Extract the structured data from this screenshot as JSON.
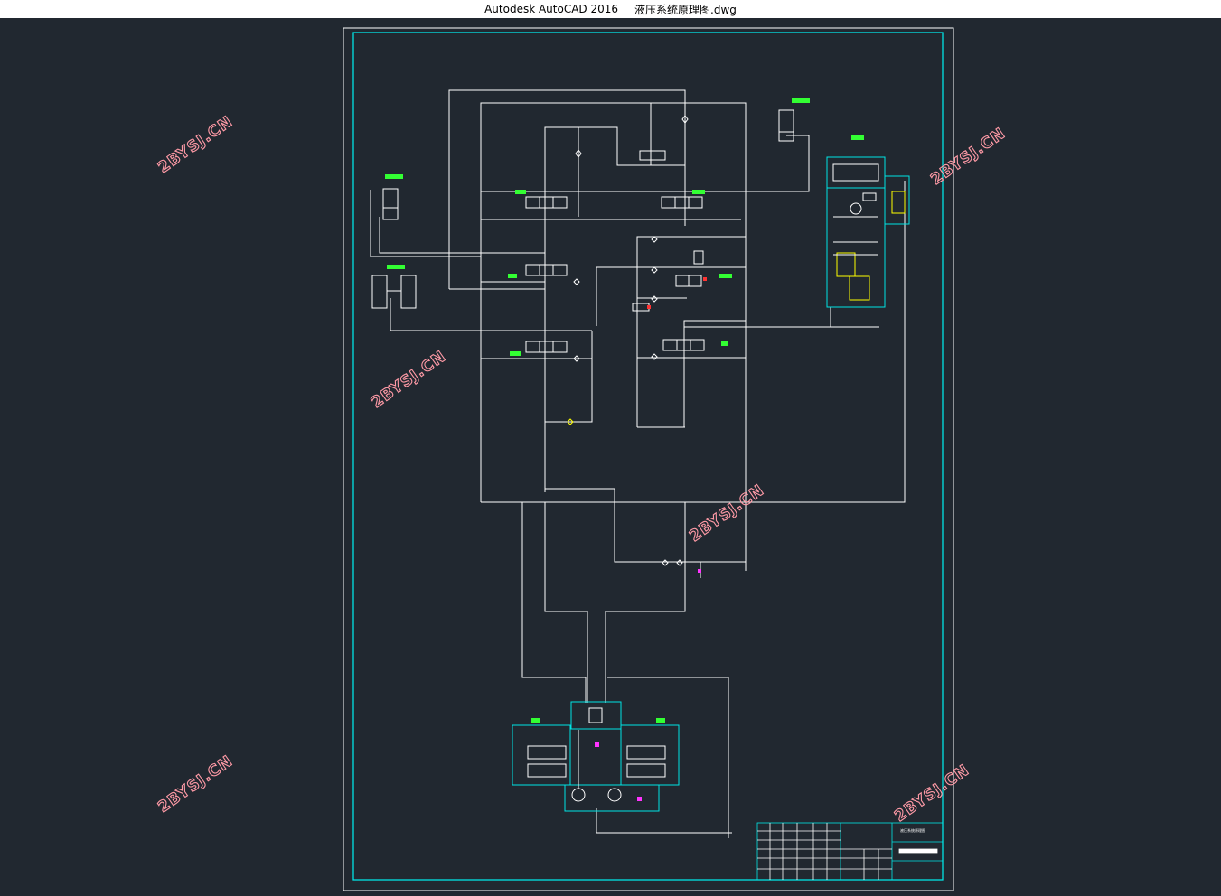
{
  "window": {
    "app_name": "Autodesk AutoCAD 2016",
    "file_name": "液压系统原理图.dwg"
  },
  "watermark": {
    "text": "2BYSJ.CN",
    "color": "#ff9aa6"
  },
  "colors": {
    "background": "#212830",
    "lines": "#ffffff",
    "frame_inner": "#00e5e5",
    "labels": "#33ff33",
    "valves_highlight": "#ffff00",
    "markers": "#ff3333",
    "accent_magenta": "#ff33ff"
  },
  "drawing": {
    "components": [
      {
        "type": "cylinder-icon"
      },
      {
        "type": "double-cylinder-icon"
      },
      {
        "type": "cylinder-icon"
      },
      {
        "type": "directional-valve-icon"
      },
      {
        "type": "directional-valve-icon"
      },
      {
        "type": "directional-valve-icon"
      },
      {
        "type": "directional-valve-icon"
      },
      {
        "type": "directional-valve-icon"
      },
      {
        "type": "directional-valve-icon"
      },
      {
        "type": "pump-unit-icon"
      },
      {
        "type": "motor-module-icon"
      }
    ]
  },
  "title_block": {
    "sheet_name": "液压系统原理图"
  }
}
